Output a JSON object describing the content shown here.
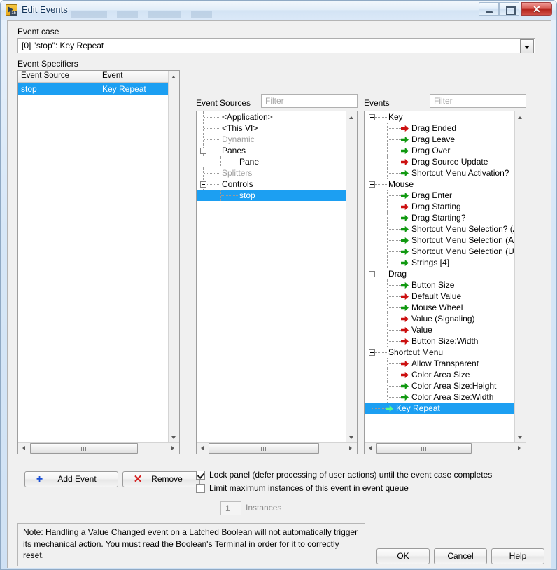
{
  "window": {
    "title": "Edit Events",
    "icon": "labview-icon",
    "buttons": {
      "minimize": "minimize-button",
      "maximize": "maximize-button",
      "close": "close-button"
    }
  },
  "event_case": {
    "label": "Event case",
    "value": "[0] \"stop\": Key Repeat"
  },
  "event_specifiers": {
    "label": "Event Specifiers",
    "columns": [
      "Event Source",
      "Event"
    ],
    "rows": [
      {
        "source": "stop",
        "event": "Key Repeat",
        "selected": true
      }
    ]
  },
  "event_sources": {
    "label": "Event Sources",
    "filter_placeholder": "Filter",
    "filter_value": "",
    "nodes": [
      {
        "label": "<Application>",
        "depth": 1,
        "kind": "leaf",
        "dim": false,
        "selected": false
      },
      {
        "label": "<This VI>",
        "depth": 1,
        "kind": "leaf",
        "dim": false,
        "selected": false
      },
      {
        "label": "Dynamic",
        "depth": 1,
        "kind": "leaf",
        "dim": true,
        "selected": false
      },
      {
        "label": "Panes",
        "depth": 1,
        "kind": "parent",
        "dim": false,
        "selected": false
      },
      {
        "label": "Pane",
        "depth": 2,
        "kind": "leaf",
        "dim": false,
        "selected": false
      },
      {
        "label": "Splitters",
        "depth": 1,
        "kind": "leaf",
        "dim": true,
        "selected": false
      },
      {
        "label": "Controls",
        "depth": 1,
        "kind": "parent",
        "dim": false,
        "selected": false
      },
      {
        "label": "stop",
        "depth": 2,
        "kind": "leaf",
        "dim": false,
        "selected": true
      }
    ]
  },
  "events": {
    "label": "Events",
    "filter_placeholder": "Filter",
    "filter_value": "",
    "nodes": [
      {
        "label": "Key",
        "depth": 1,
        "kind": "parent",
        "arrow": "none",
        "selected": false
      },
      {
        "label": "Drag Ended",
        "depth": 2,
        "kind": "leaf",
        "arrow": "red",
        "selected": false
      },
      {
        "label": "Drag Leave",
        "depth": 2,
        "kind": "leaf",
        "arrow": "green",
        "selected": false
      },
      {
        "label": "Drag Over",
        "depth": 2,
        "kind": "leaf",
        "arrow": "green",
        "selected": false
      },
      {
        "label": "Drag Source Update",
        "depth": 2,
        "kind": "leaf",
        "arrow": "red",
        "selected": false
      },
      {
        "label": "Shortcut Menu Activation?",
        "depth": 2,
        "kind": "leaf",
        "arrow": "green",
        "selected": false
      },
      {
        "label": "Mouse",
        "depth": 1,
        "kind": "parent",
        "arrow": "none",
        "selected": false
      },
      {
        "label": "Drag Enter",
        "depth": 2,
        "kind": "leaf",
        "arrow": "green",
        "selected": false
      },
      {
        "label": "Drag Starting",
        "depth": 2,
        "kind": "leaf",
        "arrow": "red",
        "selected": false
      },
      {
        "label": "Drag Starting?",
        "depth": 2,
        "kind": "leaf",
        "arrow": "green",
        "selected": false
      },
      {
        "label": "Shortcut Menu Selection? (Ap",
        "depth": 2,
        "kind": "leaf",
        "arrow": "green",
        "selected": false
      },
      {
        "label": "Shortcut Menu Selection (App",
        "depth": 2,
        "kind": "leaf",
        "arrow": "green",
        "selected": false
      },
      {
        "label": "Shortcut Menu Selection (Use",
        "depth": 2,
        "kind": "leaf",
        "arrow": "green",
        "selected": false
      },
      {
        "label": "Strings [4]",
        "depth": 2,
        "kind": "leaf",
        "arrow": "green",
        "selected": false
      },
      {
        "label": "Drag",
        "depth": 1,
        "kind": "parent",
        "arrow": "none",
        "selected": false
      },
      {
        "label": "Button Size",
        "depth": 2,
        "kind": "leaf",
        "arrow": "green",
        "selected": false
      },
      {
        "label": "Default Value",
        "depth": 2,
        "kind": "leaf",
        "arrow": "red",
        "selected": false
      },
      {
        "label": "Mouse Wheel",
        "depth": 2,
        "kind": "leaf",
        "arrow": "green",
        "selected": false
      },
      {
        "label": "Value (Signaling)",
        "depth": 2,
        "kind": "leaf",
        "arrow": "red",
        "selected": false
      },
      {
        "label": "Value",
        "depth": 2,
        "kind": "leaf",
        "arrow": "red",
        "selected": false
      },
      {
        "label": "Button Size:Width",
        "depth": 2,
        "kind": "leaf",
        "arrow": "red",
        "selected": false
      },
      {
        "label": "Shortcut Menu",
        "depth": 1,
        "kind": "parent",
        "arrow": "none",
        "selected": false
      },
      {
        "label": "Allow Transparent",
        "depth": 2,
        "kind": "leaf",
        "arrow": "red",
        "selected": false
      },
      {
        "label": "Color Area Size",
        "depth": 2,
        "kind": "leaf",
        "arrow": "red",
        "selected": false
      },
      {
        "label": "Color Area Size:Height",
        "depth": 2,
        "kind": "leaf",
        "arrow": "green",
        "selected": false
      },
      {
        "label": "Color Area Size:Width",
        "depth": 2,
        "kind": "leaf",
        "arrow": "green",
        "selected": false
      },
      {
        "label": "Key Repeat",
        "depth": 1,
        "kind": "leaf",
        "arrow": "green",
        "selected": true
      }
    ]
  },
  "actions": {
    "add_event": "Add Event",
    "remove": "Remove",
    "add_icon": "plus-icon",
    "remove_icon": "x-icon"
  },
  "options": {
    "lock_panel": {
      "label": "Lock panel (defer processing of user actions) until the event case completes",
      "checked": true
    },
    "limit_instances": {
      "label": "Limit maximum instances of this event in event queue",
      "checked": false
    },
    "instances": {
      "value": "1",
      "label": "Instances"
    }
  },
  "note": {
    "text": "Note:  Handling a Value Changed event on a Latched Boolean will not automatically trigger its mechanical action. You must read the Boolean's Terminal in order for it to correctly reset."
  },
  "dialog_buttons": {
    "ok": "OK",
    "cancel": "Cancel",
    "help": "Help"
  },
  "colors": {
    "selection": "#1c9ff2",
    "notify_arrow": "#cc1111",
    "filter_arrow": "#119911",
    "dim_text": "#a0a0a0"
  }
}
